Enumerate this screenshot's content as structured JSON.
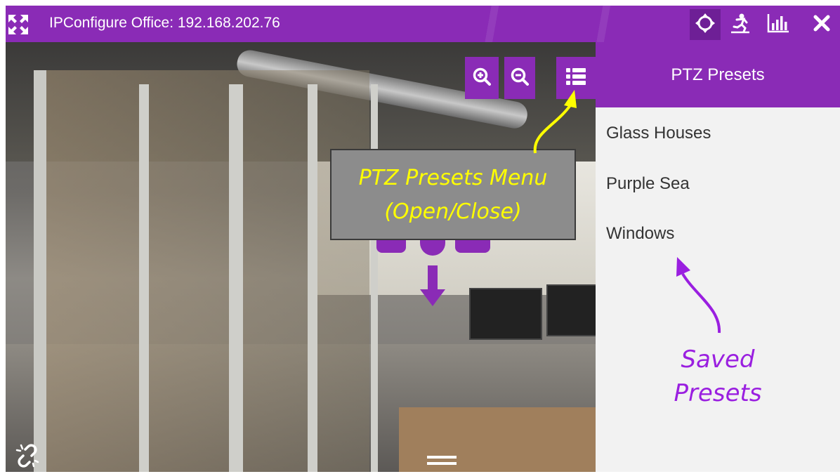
{
  "window": {
    "title": "IPConfigure Office: 192.168.202.76",
    "accent_color": "#8a2bb6",
    "toolbar_icons": [
      "crosshair-icon",
      "running-figure-icon",
      "bar-chart-icon",
      "close-icon"
    ]
  },
  "view_controls": {
    "icons": [
      "zoom-in-icon",
      "zoom-out-icon",
      "presets-list-icon"
    ]
  },
  "ptz_presets": {
    "header": "PTZ Presets",
    "items": [
      "Glass Houses",
      "Purple Sea",
      "Windows"
    ]
  },
  "annotations": {
    "menu_callout_line1": "PTZ Presets Menu",
    "menu_callout_line2": "(Open/Close)",
    "saved_line1": "Saved",
    "saved_line2": "Presets",
    "callout_text_color": "#ffff00",
    "saved_text_color": "#9a1fe0"
  }
}
